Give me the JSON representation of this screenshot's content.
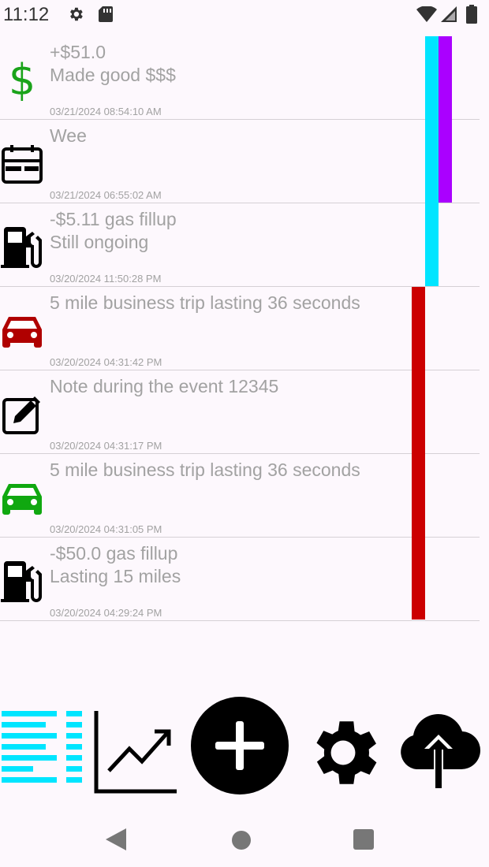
{
  "status_bar": {
    "time": "11:12",
    "icons": [
      "gear-icon",
      "sd-card-icon",
      "wifi-icon",
      "signal-icon",
      "battery-icon"
    ]
  },
  "entries": [
    {
      "icon": "dollar-icon",
      "icon_color": "#1aa31a",
      "line1": "+$51.0",
      "line2": "Made good $$$",
      "timestamp": "03/21/2024 08:54:10 AM"
    },
    {
      "icon": "card-icon",
      "icon_color": "#000000",
      "line1": "Wee",
      "line2": "",
      "timestamp": "03/21/2024 06:55:02 AM"
    },
    {
      "icon": "gas-pump-icon",
      "icon_color": "#000000",
      "line1": "-$5.11 gas fillup",
      "line2": "Still ongoing",
      "timestamp": "03/20/2024 11:50:28 PM"
    },
    {
      "icon": "car-icon",
      "icon_color": "#b00000",
      "line1": "5 mile business trip lasting 36 seconds",
      "line2": "",
      "timestamp": "03/20/2024 04:31:42 PM"
    },
    {
      "icon": "edit-note-icon",
      "icon_color": "#000000",
      "line1": "Note during the event 12345",
      "line2": "",
      "timestamp": "03/20/2024 04:31:17 PM"
    },
    {
      "icon": "car-icon",
      "icon_color": "#10a810",
      "line1": "5 mile business trip lasting 36 seconds",
      "line2": "",
      "timestamp": "03/20/2024 04:31:05 PM"
    },
    {
      "icon": "gas-pump-icon",
      "icon_color": "#000000",
      "line1": "-$50.0 gas fillup",
      "line2": "Lasting 15 miles",
      "timestamp": "03/20/2024 04:29:24 PM"
    }
  ],
  "timeline_colors": {
    "cyan": "#00e5ff",
    "purple": "#aa00ff",
    "red": "#cc0000"
  },
  "bottom_nav": [
    "list-icon",
    "chart-icon",
    "add-icon",
    "settings-icon",
    "cloud-upload-icon"
  ],
  "system_nav": [
    "back-icon",
    "home-icon",
    "recents-icon"
  ]
}
